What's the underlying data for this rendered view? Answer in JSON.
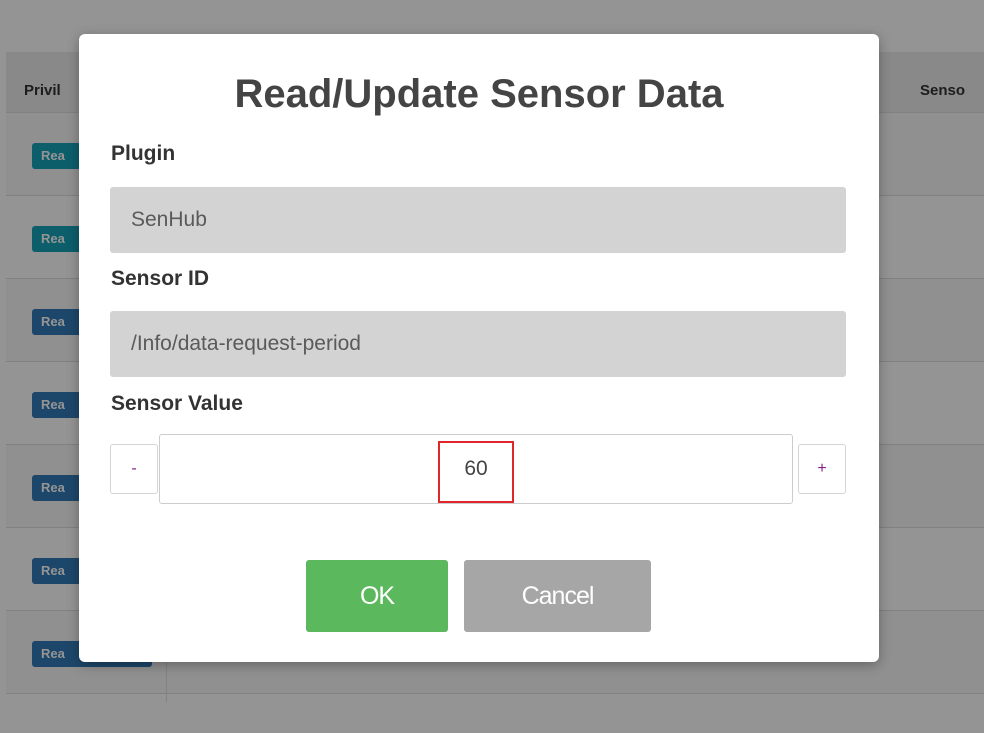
{
  "background": {
    "header_left": "Privil",
    "header_right": "Senso",
    "row_badges": [
      "Rea",
      "Rea",
      "Rea",
      "Rea",
      "Rea",
      "Rea",
      "Rea"
    ]
  },
  "modal": {
    "title": "Read/Update Sensor Data",
    "plugin": {
      "label": "Plugin",
      "value": "SenHub"
    },
    "sensor_id": {
      "label": "Sensor ID",
      "value": "/Info/data-request-period"
    },
    "sensor_value": {
      "label": "Sensor Value",
      "value": "60",
      "decrement_label": "-",
      "increment_label": "+"
    },
    "ok_label": "OK",
    "cancel_label": "Cancel"
  },
  "colors": {
    "ok_button": "#5cb85c",
    "cancel_button": "#a6a6a6",
    "readonly_field": "#d3d3d3",
    "highlight": "#e0262d"
  }
}
